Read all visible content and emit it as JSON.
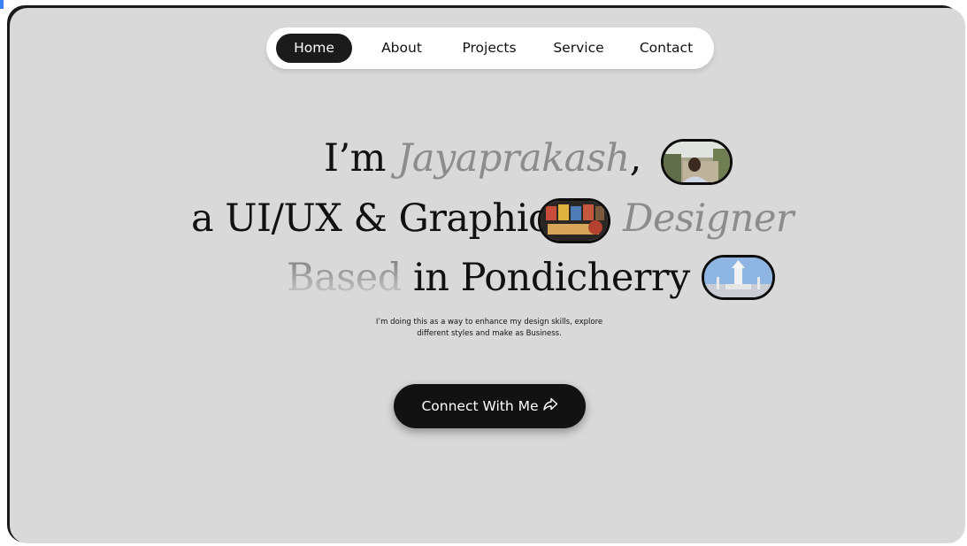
{
  "nav": {
    "items": [
      {
        "label": "Home",
        "active": true
      },
      {
        "label": "About",
        "active": false
      },
      {
        "label": "Projects",
        "active": false
      },
      {
        "label": "Service",
        "active": false
      },
      {
        "label": "Contact",
        "active": false
      }
    ]
  },
  "hero": {
    "line1": {
      "prefix": "I’m ",
      "name": "Jayaprakash",
      "suffix": ","
    },
    "line2": {
      "prefix": "a UI/UX & Graphic ",
      "highlight": "Designer"
    },
    "line3": {
      "faded": "Based",
      "rest": " in Pondicherry"
    },
    "images": {
      "portrait": "portrait-photo",
      "design": "design-work-thumbnail",
      "landmark": "pondicherry-landmark-photo"
    },
    "description_line1": "I’m doing this as a way to enhance my design skills, explore",
    "description_line2": "different styles and make as Business."
  },
  "cta": {
    "label": "Connect With Me",
    "icon": "share-arrow-icon"
  },
  "colors": {
    "background": "#d9d9d9",
    "nav_bg": "#ffffff",
    "dark": "#121212",
    "accent_grey": "#8c8c8c"
  }
}
